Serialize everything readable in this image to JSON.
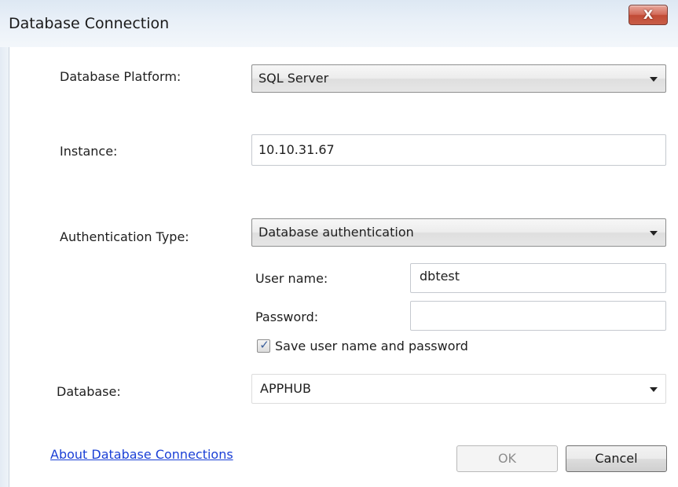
{
  "window": {
    "title": "Database Connection",
    "close_glyph": "X"
  },
  "form": {
    "platform_label": "Database Platform:",
    "platform_value": "SQL Server",
    "instance_label": "Instance:",
    "instance_value": "10.10.31.67",
    "auth_type_label": "Authentication Type:",
    "auth_type_value": "Database authentication",
    "username_label": "User name:",
    "username_value": "dbtest",
    "password_label": "Password:",
    "password_value": "",
    "save_credentials_label": "Save user name and password",
    "save_credentials_checked": true,
    "database_label": "Database:",
    "database_value": "APPHUB"
  },
  "footer": {
    "about_link": "About Database Connections",
    "ok_label": "OK",
    "ok_enabled": false,
    "cancel_label": "Cancel"
  },
  "icons": {
    "dropdown": "chevron-down-icon",
    "close": "close-icon",
    "check": "checkmark-icon"
  },
  "colors": {
    "link": "#1a3fd6",
    "close_button": "#c85d47",
    "titlebar": "#dde8f3"
  }
}
